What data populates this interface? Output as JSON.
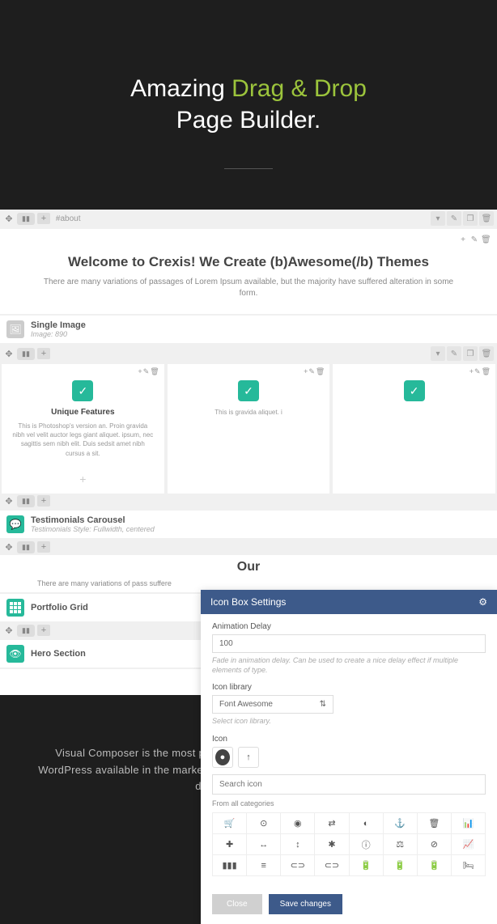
{
  "hero": {
    "title_prefix": "Amazing ",
    "title_accent": "Drag & Drop",
    "title_suffix": "Page Builder."
  },
  "builder": {
    "about_hash": "#about",
    "welcome_title": "Welcome to Crexis! We Create (b)Awesome(/b) Themes",
    "welcome_sub": "There are many variations of passages of Lorem Ipsum available, but the majority have suffered alteration in some form.",
    "single_image": {
      "name": "Single Image",
      "meta": "Image: 890"
    },
    "feature": {
      "title": "Unique Features",
      "desc": "This is Photoshop's version an. Proin gravida nibh vel velit auctor legs giant aliquet. ipsum, nec sagittis sem nibh elit. Duis sedsit amet nibh cursus a sit."
    },
    "feature_truncated": "This is gravida aliquet. i",
    "testimonials": {
      "name": "Testimonials Carousel",
      "meta": "Testimonials Style: Fullwidth, centered"
    },
    "our_title": "Our",
    "our_sub": "There are many variations of pass suffere",
    "portfolio": {
      "name": "Portfolio Grid"
    },
    "hero_section": {
      "name": "Hero Section"
    }
  },
  "modal": {
    "title": "Icon Box Settings",
    "delay_label": "Animation Delay",
    "delay_value": "100",
    "delay_help": "Fade in animation delay. Can be used to create a nice delay effect if multiple elements of type.",
    "library_label": "Icon library",
    "library_value": "Font Awesome",
    "library_help": "Select icon library.",
    "icon_label": "Icon",
    "search_placeholder": "Search icon",
    "category": "From all categories",
    "close": "Close",
    "save": "Save changes",
    "icons": [
      "🛒",
      "⊙",
      "◉",
      "⇄",
      "◐",
      "⚓",
      "🗑",
      "📊",
      "✚",
      "↔",
      "↕",
      "✱",
      "ⓘ",
      "⚖",
      "⊘",
      "📈",
      "▮▮▮",
      "≡",
      "⊂⊃",
      "⊂⊃",
      "🔋",
      "🔋",
      "🔋",
      "🛏"
    ]
  },
  "footer": {
    "text": "Visual Composer is the most powerful and most popular page builder plugin for WordPress available in the market. Easily add, remove and rearrange elements with a drag & drop interface."
  }
}
